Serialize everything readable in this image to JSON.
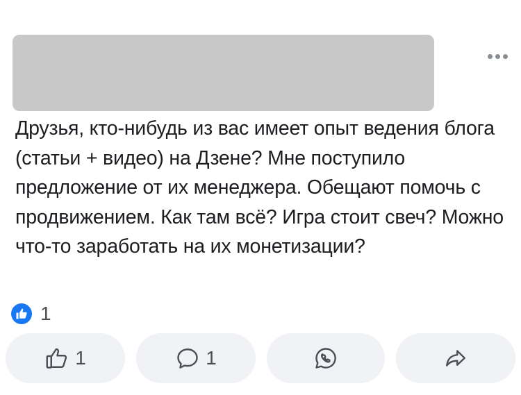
{
  "post": {
    "author_redacted": true,
    "menu_icon": "more-horizontal-icon",
    "text": "Друзья, кто-нибудь из вас имеет опыт ведения блога (статьи + видео) на Дзене? Мне поступило предложение от их менеджера. Обещают помочь с продвижением. Как там всё? Игра стоит свеч? Можно что-то заработать на их монетизации?"
  },
  "reactions": {
    "icon": "like-reaction-icon",
    "count": "1"
  },
  "actions": {
    "like": {
      "icon": "thumbs-up-icon",
      "count": "1"
    },
    "comment": {
      "icon": "comment-icon",
      "count": "1"
    },
    "whatsapp": {
      "icon": "whatsapp-icon"
    },
    "share": {
      "icon": "share-icon"
    }
  },
  "colors": {
    "accent": "#1877f2",
    "button_bg": "#f0f2f5",
    "redacted": "#c8c8c8",
    "icon_gray": "#4b4f56"
  }
}
